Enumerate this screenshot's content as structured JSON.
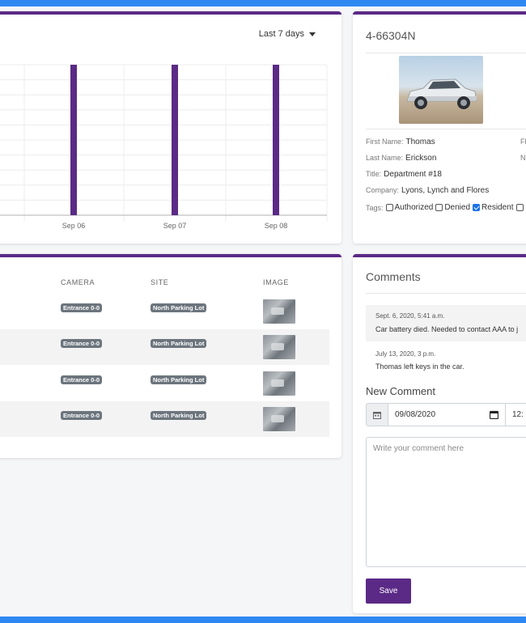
{
  "chart": {
    "range_label": "Last 7 days",
    "chart_data": {
      "type": "bar",
      "categories": [
        "Sep 06",
        "Sep 07",
        "Sep 08"
      ],
      "values": [
        1,
        1,
        1
      ],
      "ylim": [
        0,
        1
      ],
      "grid": true,
      "title": "",
      "xlabel": "",
      "ylabel": "",
      "color": "#5b2a86"
    }
  },
  "vehicle": {
    "plate": "4-66304N",
    "fields": [
      {
        "label": "First Name:",
        "value": "Thomas"
      },
      {
        "label": "Last Name:",
        "value": "Erickson"
      },
      {
        "label": "Title:",
        "value": "Department #18"
      },
      {
        "label": "Company:",
        "value": "Lyons, Lynch and Flores"
      }
    ],
    "side_labels": [
      "Fl",
      "N"
    ],
    "tags_label": "Tags:",
    "tags": [
      {
        "label": "Authorized",
        "checked": false
      },
      {
        "label": "Denied",
        "checked": false
      },
      {
        "label": "Resident",
        "checked": true
      }
    ]
  },
  "table": {
    "headers": {
      "camera": "CAMERA",
      "site": "SITE",
      "image": "IMAGE"
    },
    "rows": [
      {
        "camera": "Entrance 0-0",
        "site": "North Parking Lot"
      },
      {
        "camera": "Entrance 0-0",
        "site": "North Parking Lot"
      },
      {
        "camera": "Entrance 0-0",
        "site": "North Parking Lot"
      },
      {
        "camera": "Entrance 0-0",
        "site": "North Parking Lot"
      }
    ]
  },
  "comments": {
    "title": "Comments",
    "items": [
      {
        "date": "Sept. 6, 2020, 5:41 a.m.",
        "text": "Car battery died. Needed to contact AAA to j"
      },
      {
        "date": "July 13, 2020, 3 p.m.",
        "text": "Thomas left keys in the car."
      }
    ],
    "new_comment_title": "New Comment",
    "date_value": "09/08/2020",
    "time_value": "12:",
    "placeholder": "Write your comment here",
    "save_label": "Save"
  },
  "colors": {
    "accent": "#5b2a86",
    "frame": "#2f88f2",
    "checkbox": "#1a73e8"
  }
}
